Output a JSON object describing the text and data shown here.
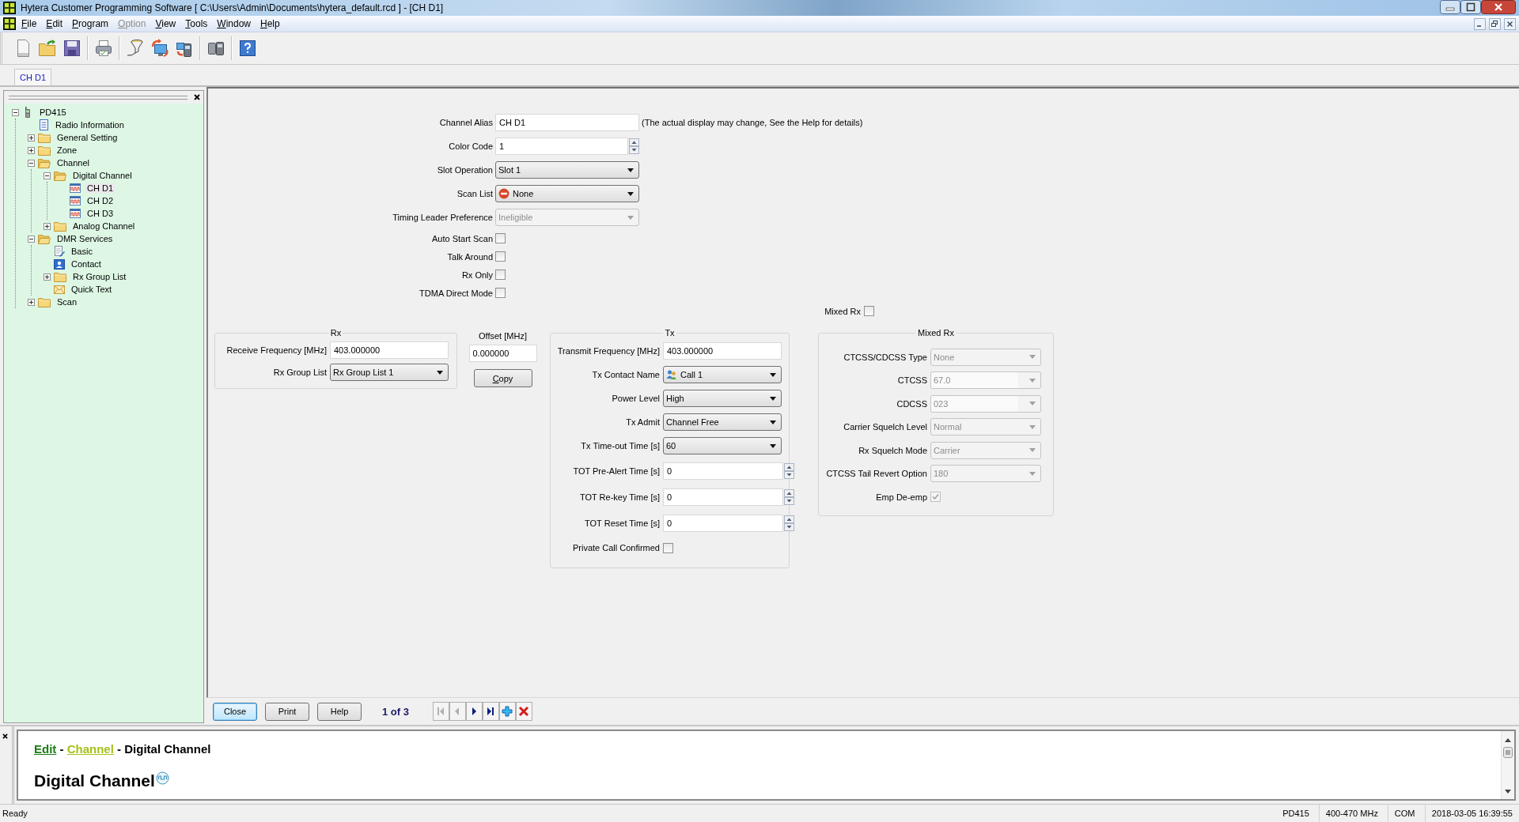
{
  "window": {
    "title": "Hytera Customer Programming Software [ C:\\Users\\Admin\\Documents\\hytera_default.rcd ] - [CH D1]"
  },
  "menu_bar": [
    {
      "label": "File",
      "disabled": false
    },
    {
      "label": "Edit",
      "disabled": false
    },
    {
      "label": "Program",
      "disabled": false
    },
    {
      "label": "Option",
      "disabled": true
    },
    {
      "label": "View",
      "disabled": false
    },
    {
      "label": "Tools",
      "disabled": false
    },
    {
      "label": "Window",
      "disabled": false
    },
    {
      "label": "Help",
      "disabled": false
    }
  ],
  "document_tabs": [
    {
      "label": "CH D1",
      "selected": true
    }
  ],
  "tree": [
    {
      "label": "PD415",
      "kind": "radio",
      "expanded": true,
      "selected": false,
      "children": [
        {
          "label": "Radio Information",
          "kind": "info",
          "selected": false
        },
        {
          "label": "General Setting",
          "kind": "folder",
          "expanded": false,
          "selected": false
        },
        {
          "label": "Zone",
          "kind": "folder",
          "expanded": false,
          "selected": false
        },
        {
          "label": "Channel",
          "kind": "folder",
          "expanded": true,
          "selected": false,
          "children": [
            {
              "label": "Digital Channel",
              "kind": "folder",
              "expanded": true,
              "selected": false,
              "children": [
                {
                  "label": "CH D1",
                  "kind": "channel",
                  "selected": true
                },
                {
                  "label": "CH D2",
                  "kind": "channel",
                  "selected": false
                },
                {
                  "label": "CH D3",
                  "kind": "channel",
                  "selected": false
                }
              ]
            },
            {
              "label": "Analog Channel",
              "kind": "folder",
              "expanded": false,
              "selected": false
            }
          ]
        },
        {
          "label": "DMR Services",
          "kind": "folder",
          "expanded": true,
          "selected": false,
          "children": [
            {
              "label": "Basic",
              "kind": "settings",
              "selected": false
            },
            {
              "label": "Contact",
              "kind": "contact",
              "selected": false
            },
            {
              "label": "Rx Group List",
              "kind": "folder",
              "expanded": false,
              "selected": false
            },
            {
              "label": "Quick Text",
              "kind": "message",
              "selected": false
            }
          ]
        },
        {
          "label": "Scan",
          "kind": "folder",
          "expanded": false,
          "selected": false
        }
      ]
    }
  ],
  "top_fields": [
    {
      "label": "Channel Alias",
      "kind": "text",
      "value": "CH D1",
      "note": "(The actual display may change, See the Help for details)",
      "disabled": false
    },
    {
      "label": "Color Code",
      "kind": "spin",
      "value": "1",
      "disabled": false
    },
    {
      "label": "Slot Operation",
      "kind": "select",
      "value": "Slot 1",
      "disabled": false
    },
    {
      "label": "Scan List",
      "kind": "icon_select",
      "value": "None",
      "disabled": false
    },
    {
      "label": "Timing Leader Preference",
      "kind": "select",
      "value": "Ineligible",
      "disabled": true
    },
    {
      "label": "Auto Start Scan",
      "kind": "checkbox",
      "checked": false,
      "disabled": false
    },
    {
      "label": "Talk Around",
      "kind": "checkbox",
      "checked": false,
      "disabled": false
    },
    {
      "label": "Rx Only",
      "kind": "checkbox",
      "checked": false,
      "disabled": false
    },
    {
      "label": "TDMA Direct Mode",
      "kind": "checkbox",
      "checked": false,
      "disabled": false
    }
  ],
  "mixed_rx_toggle": {
    "label": "Mixed Rx",
    "checked": false
  },
  "rx_group": {
    "title": "Rx",
    "fields": [
      {
        "label": "Receive Frequency [MHz]",
        "kind": "text",
        "value": "403.000000",
        "disabled": false
      },
      {
        "label": "Rx Group List",
        "kind": "select",
        "value": "Rx Group List 1",
        "disabled": false
      }
    ]
  },
  "offset": {
    "label": "Offset [MHz]",
    "value": "0.000000",
    "button": "Copy"
  },
  "tx_group": {
    "title": "Tx",
    "fields": [
      {
        "label": "Transmit Frequency [MHz]",
        "kind": "text",
        "value": "403.000000",
        "disabled": false
      },
      {
        "label": "Tx Contact Name",
        "kind": "icon_select",
        "value": "Call 1",
        "disabled": false
      },
      {
        "label": "Power Level",
        "kind": "select",
        "value": "High",
        "disabled": false
      },
      {
        "label": "Tx Admit",
        "kind": "select",
        "value": "Channel Free",
        "disabled": false
      },
      {
        "label": "Tx Time-out Time [s]",
        "kind": "select",
        "value": "60",
        "disabled": false
      },
      {
        "label": "TOT Pre-Alert Time [s]",
        "kind": "spin",
        "value": "0",
        "disabled": false
      },
      {
        "label": "TOT Re-key Time [s]",
        "kind": "spin",
        "value": "0",
        "disabled": false
      },
      {
        "label": "TOT Reset Time [s]",
        "kind": "spin",
        "value": "0",
        "disabled": false
      },
      {
        "label": "Private Call Confirmed",
        "kind": "checkbox",
        "checked": false,
        "disabled": false
      }
    ]
  },
  "mixed_rx_group": {
    "title": "Mixed Rx",
    "fields": [
      {
        "label": "CTCSS/CDCSS Type",
        "kind": "select",
        "value": "None",
        "disabled": true
      },
      {
        "label": "CTCSS",
        "kind": "combo",
        "value": "67.0",
        "disabled": true
      },
      {
        "label": "CDCSS",
        "kind": "combo",
        "value": "023",
        "disabled": true
      },
      {
        "label": "Carrier Squelch Level",
        "kind": "select",
        "value": "Normal",
        "disabled": true
      },
      {
        "label": "Rx Squelch Mode",
        "kind": "select",
        "value": "Carrier",
        "disabled": true
      },
      {
        "label": "CTCSS Tail Revert Option",
        "kind": "select",
        "value": "180",
        "disabled": true
      },
      {
        "label": "Emp De-emp",
        "kind": "checkbox",
        "checked": true,
        "disabled": true
      }
    ]
  },
  "footer": {
    "buttons": [
      {
        "label": "Close",
        "focused": true
      },
      {
        "label": "Print",
        "focused": false
      },
      {
        "label": "Help",
        "focused": false
      }
    ],
    "pager": "1 of 3",
    "nav_buttons": [
      {
        "kind": "first",
        "disabled": true
      },
      {
        "kind": "previous",
        "disabled": true
      },
      {
        "kind": "next",
        "disabled": false
      },
      {
        "kind": "last",
        "disabled": false
      },
      {
        "kind": "add",
        "disabled": false
      },
      {
        "kind": "delete",
        "disabled": false
      }
    ]
  },
  "help_pane": {
    "breadcrumb": [
      {
        "label": "Edit",
        "kind": "link",
        "color": "#1e7d14"
      },
      {
        "label": "-",
        "kind": "separator"
      },
      {
        "label": "Channel",
        "kind": "link",
        "color": "#a4c21a"
      },
      {
        "label": "-",
        "kind": "separator"
      },
      {
        "label": "Digital Channel",
        "kind": "text"
      }
    ],
    "heading": "Digital Channel"
  },
  "status_bar": {
    "message": "Ready",
    "panes": [
      "PD415",
      "400-470 MHz",
      "COM",
      "2018-03-05 16:39:55"
    ]
  }
}
